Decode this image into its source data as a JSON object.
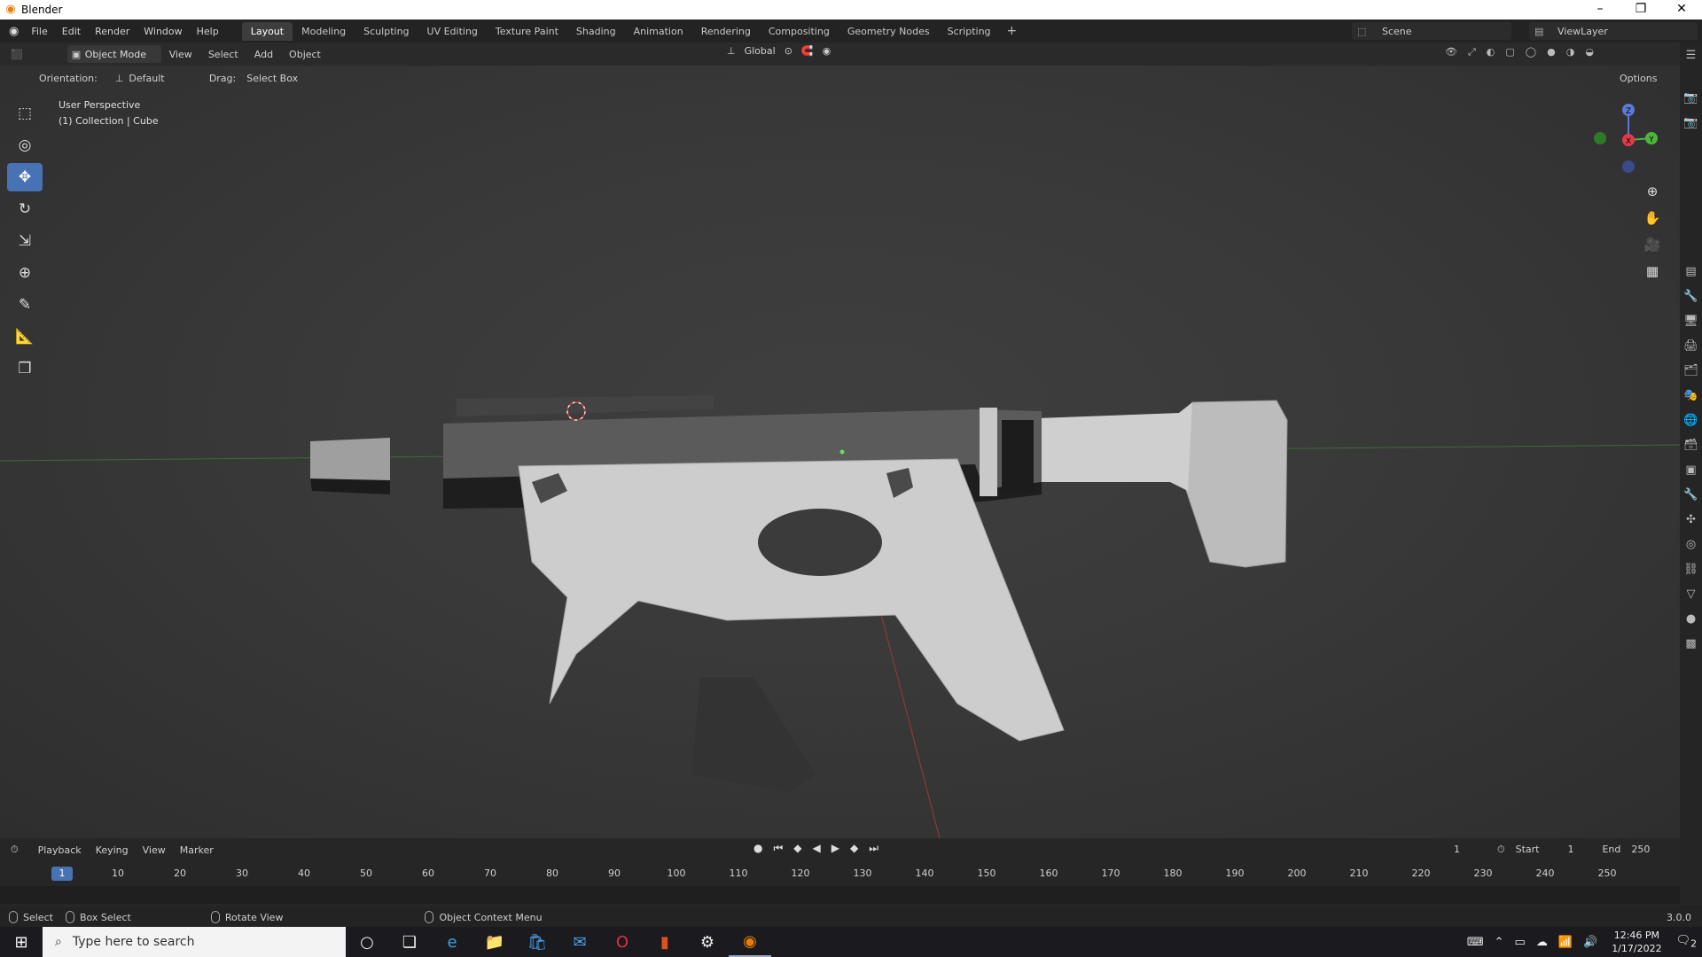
{
  "window": {
    "title": "Blender",
    "controls": [
      "–",
      "❐",
      "✕"
    ]
  },
  "menu": {
    "items": [
      "File",
      "Edit",
      "Render",
      "Window",
      "Help"
    ]
  },
  "workspaces": {
    "tabs": [
      "Layout",
      "Modeling",
      "Sculpting",
      "UV Editing",
      "Texture Paint",
      "Shading",
      "Animation",
      "Rendering",
      "Compositing",
      "Geometry Nodes",
      "Scripting"
    ],
    "active": "Layout",
    "add_label": "+"
  },
  "scene": {
    "name": "Scene"
  },
  "view_layer": {
    "name": "ViewLayer"
  },
  "header": {
    "mode": "Object Mode",
    "menus": [
      "View",
      "Select",
      "Add",
      "Object"
    ],
    "transform_orientation": "Global"
  },
  "tool_settings": {
    "orientation_label": "Orientation:",
    "orientation_value": "Default",
    "drag_label": "Drag:",
    "drag_value": "Select Box",
    "options_label": "Options"
  },
  "viewport": {
    "view_name": "User Perspective",
    "collection": "(1) Collection | Cube",
    "gizmo_axes": {
      "x": "X",
      "y": "Y",
      "z": "Z"
    },
    "colors": {
      "x_axis": "#e23b4c",
      "y_axis": "#4fb63c",
      "z_axis": "#5a7bd8",
      "active_tool": "#4772b3"
    }
  },
  "toolbar": {
    "tools": [
      "select-box-icon",
      "cursor-icon",
      "move-icon",
      "rotate-icon",
      "scale-icon",
      "transform-icon",
      "annotate-icon",
      "measure-icon",
      "add-cube-icon"
    ],
    "active": "move-icon"
  },
  "timeline": {
    "menus": [
      "Playback",
      "Keying",
      "View",
      "Marker"
    ],
    "current_frame": "1",
    "start_label": "Start",
    "start": "1",
    "end_label": "End",
    "end": "250",
    "ticks": [
      "10",
      "20",
      "30",
      "40",
      "50",
      "60",
      "70",
      "80",
      "90",
      "100",
      "110",
      "120",
      "130",
      "140",
      "150",
      "160",
      "170",
      "180",
      "190",
      "200",
      "210",
      "220",
      "230",
      "240",
      "250"
    ]
  },
  "statusbar": {
    "select": "Select",
    "box_select": "Box Select",
    "rotate_view": "Rotate View",
    "context_menu": "Object Context Menu",
    "version": "3.0.0"
  },
  "taskbar": {
    "search_placeholder": "Type here to search",
    "time": "12:46 PM",
    "date": "1/17/2022",
    "notifications": "2"
  }
}
